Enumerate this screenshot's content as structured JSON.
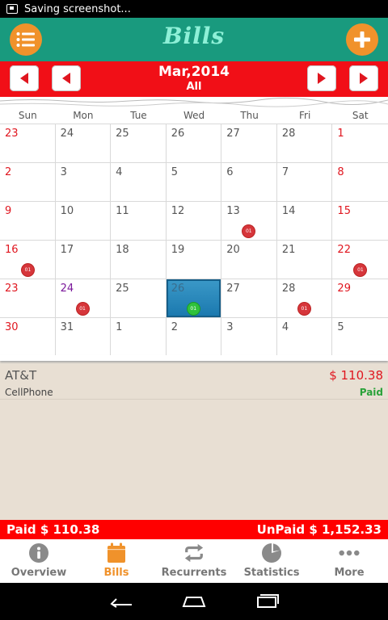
{
  "status_bar": {
    "notification": "Saving screenshot..."
  },
  "app_bar": {
    "title": "Bills"
  },
  "month_bar": {
    "month": "Mar,2014",
    "filter": "All"
  },
  "calendar": {
    "weekdays": [
      "Sun",
      "Mon",
      "Tue",
      "Wed",
      "Thu",
      "Fri",
      "Sat"
    ],
    "days": [
      {
        "d": "23",
        "t": "weekend"
      },
      {
        "d": "24",
        "t": "other"
      },
      {
        "d": "25",
        "t": "other"
      },
      {
        "d": "26",
        "t": "other"
      },
      {
        "d": "27",
        "t": "other"
      },
      {
        "d": "28",
        "t": "other"
      },
      {
        "d": "1",
        "t": "weekend"
      },
      {
        "d": "2",
        "t": "weekend"
      },
      {
        "d": "3",
        "t": ""
      },
      {
        "d": "4",
        "t": ""
      },
      {
        "d": "5",
        "t": ""
      },
      {
        "d": "6",
        "t": ""
      },
      {
        "d": "7",
        "t": ""
      },
      {
        "d": "8",
        "t": "weekend"
      },
      {
        "d": "9",
        "t": "weekend"
      },
      {
        "d": "10",
        "t": ""
      },
      {
        "d": "11",
        "t": ""
      },
      {
        "d": "12",
        "t": ""
      },
      {
        "d": "13",
        "t": "",
        "badge": "01"
      },
      {
        "d": "14",
        "t": ""
      },
      {
        "d": "15",
        "t": "weekend"
      },
      {
        "d": "16",
        "t": "weekend",
        "badge": "01"
      },
      {
        "d": "17",
        "t": ""
      },
      {
        "d": "18",
        "t": ""
      },
      {
        "d": "19",
        "t": ""
      },
      {
        "d": "20",
        "t": ""
      },
      {
        "d": "21",
        "t": ""
      },
      {
        "d": "22",
        "t": "weekend",
        "badge": "01"
      },
      {
        "d": "23",
        "t": "weekend"
      },
      {
        "d": "24",
        "t": "purple",
        "badge": "01"
      },
      {
        "d": "25",
        "t": ""
      },
      {
        "d": "26",
        "t": "today",
        "badge": "01",
        "badge_color": "green"
      },
      {
        "d": "27",
        "t": ""
      },
      {
        "d": "28",
        "t": "",
        "badge": "01"
      },
      {
        "d": "29",
        "t": "weekend"
      },
      {
        "d": "30",
        "t": "weekend"
      },
      {
        "d": "31",
        "t": ""
      },
      {
        "d": "1",
        "t": "other"
      },
      {
        "d": "2",
        "t": "other"
      },
      {
        "d": "3",
        "t": "other"
      },
      {
        "d": "4",
        "t": "other"
      },
      {
        "d": "5",
        "t": "other"
      }
    ]
  },
  "bill": {
    "name": "AT&T",
    "amount": "$ 110.38",
    "category": "CellPhone",
    "status": "Paid"
  },
  "totals": {
    "paid": "Paid $ 110.38",
    "unpaid": "UnPaid $ 1,152.33"
  },
  "tabs": [
    {
      "label": "Overview",
      "icon": "info-icon"
    },
    {
      "label": "Bills",
      "icon": "calendar-icon"
    },
    {
      "label": "Recurrents",
      "icon": "repeat-icon"
    },
    {
      "label": "Statistics",
      "icon": "pie-chart-icon"
    },
    {
      "label": "More",
      "icon": "more-icon"
    }
  ],
  "colors": {
    "teal": "#199a7e",
    "orange": "#f0922b",
    "red": "#f10f17",
    "paid_green": "#2aa23a"
  }
}
